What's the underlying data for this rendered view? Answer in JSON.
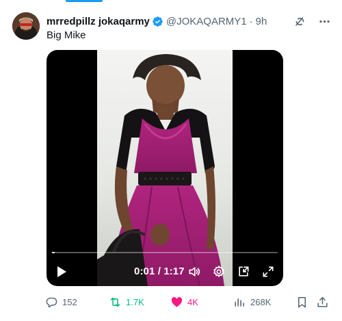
{
  "tweet": {
    "display_name": "mrredpillz jokaqarmy",
    "handle": "@JOKAQARMY1",
    "separator": "·",
    "time": "9h",
    "text": "Big Mike"
  },
  "video": {
    "time_readout": "0:01 / 1:17",
    "progress_fraction": 0.013
  },
  "actions": {
    "replies": "152",
    "retweets": "1.7K",
    "likes": "4K",
    "views": "268K"
  },
  "colors": {
    "accent": "#1d9bf0",
    "retweet": "#00ba7c",
    "like": "#f91880",
    "muted": "#536471"
  }
}
